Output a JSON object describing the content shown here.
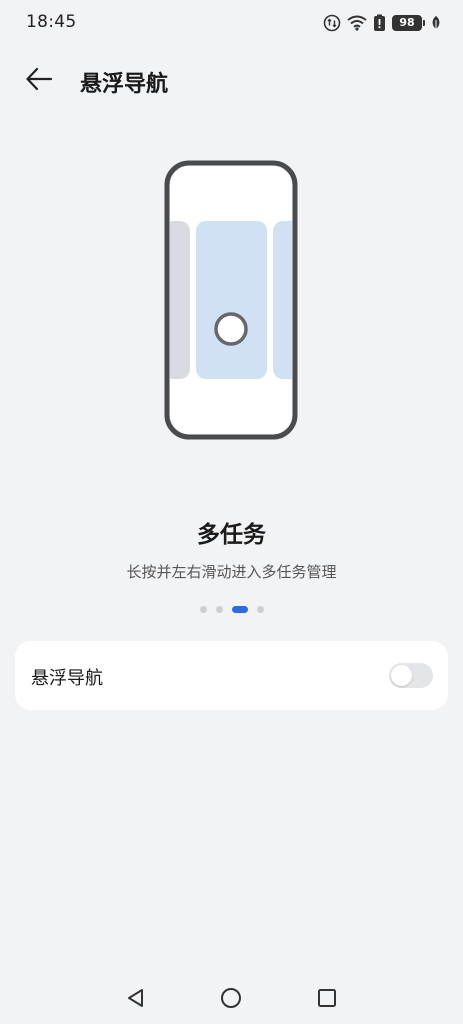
{
  "status_bar": {
    "time": "18:45",
    "battery_level": "98",
    "icons": [
      "data-activity-icon",
      "wifi-icon",
      "battery-saver-icon",
      "battery-icon",
      "leaf-icon"
    ]
  },
  "header": {
    "title": "悬浮导航",
    "back_icon": "arrow-left-icon"
  },
  "illustration": {
    "description_icon": "phone-multitask-illustration",
    "accent_color": "#d0e1f4",
    "side_card_color": "#d8dbe2",
    "frame_color": "#4a4b4f"
  },
  "feature": {
    "title": "多任务",
    "description": "长按并左右滑动进入多任务管理"
  },
  "pager": {
    "count": 4,
    "active_index": 2,
    "active_color": "#2d6be4"
  },
  "settings": {
    "floating_nav": {
      "label": "悬浮导航",
      "enabled": false
    }
  },
  "nav_bar": {
    "buttons": [
      "back-triangle-icon",
      "home-circle-icon",
      "recents-square-icon"
    ]
  }
}
